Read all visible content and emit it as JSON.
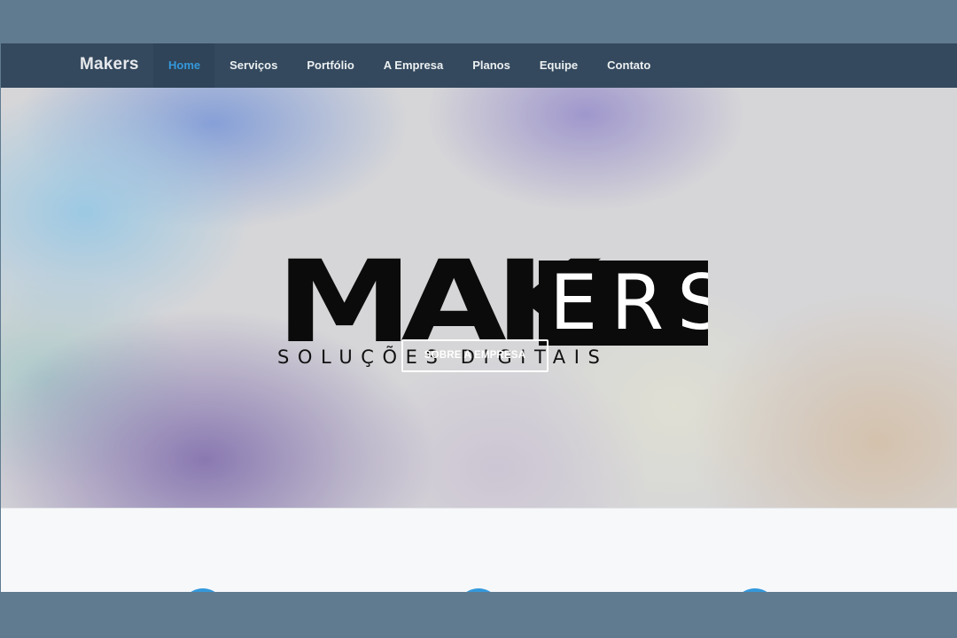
{
  "navbar": {
    "brand": "Makers",
    "items": [
      {
        "label": "Home",
        "active": true
      },
      {
        "label": "Serviços"
      },
      {
        "label": "Portfólio"
      },
      {
        "label": "A Empresa"
      },
      {
        "label": "Planos"
      },
      {
        "label": "Equipe"
      },
      {
        "label": "Contato"
      }
    ]
  },
  "hero": {
    "logo_part1": "MAK",
    "logo_part2": "ERS",
    "logo_tagline": "SOLUÇÕES DIGITAIS",
    "button_label": "SOBRE A EMPRESA"
  },
  "features": {
    "icons": [
      "feature-icon",
      "feature-icon",
      "feature-icon"
    ]
  },
  "colors": {
    "navbar": "#34495e",
    "accent": "#3498db",
    "frame_background": "#607b8f"
  }
}
